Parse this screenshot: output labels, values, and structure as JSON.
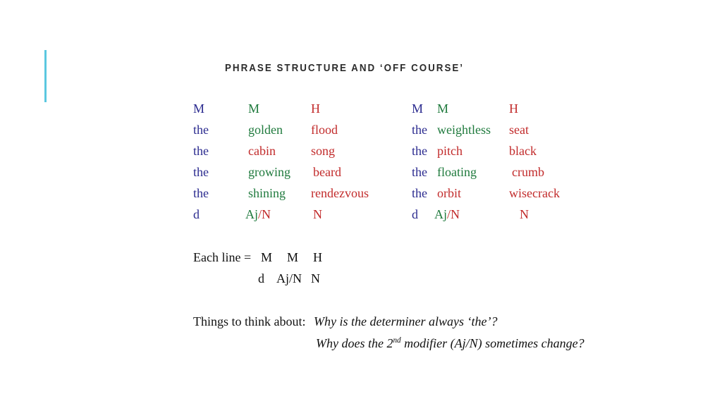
{
  "slide": {
    "title": "PHRASE STRUCTURE AND ‘OFF COURSE’",
    "accent_color": "#5BC8E0",
    "colors": {
      "modifier_1": "#2B2B8F",
      "modifier_2": "#1F7A3D",
      "head": "#C22B2B",
      "title": "#2b2b2b",
      "body": "#111111"
    }
  },
  "tables": {
    "left": {
      "header": {
        "m1": "M",
        "m2": "M",
        "head": "H"
      },
      "rows": [
        {
          "m1": "the",
          "m2": "golden",
          "m2_color": "modifier_2",
          "head": "flood"
        },
        {
          "m1": "the",
          "m2": "cabin",
          "m2_color": "head",
          "head": "song"
        },
        {
          "m1": "the",
          "m2": "growing",
          "m2_color": "modifier_2",
          "head": "beard"
        },
        {
          "m1": "the",
          "m2": "shining",
          "m2_color": "modifier_2",
          "head": "rendezvous"
        }
      ],
      "footer": {
        "m1": "d",
        "m2_adj": "Aj",
        "m2_sep": "/",
        "m2_noun": "N",
        "head": "N"
      }
    },
    "right": {
      "header": {
        "m1": "M",
        "m2": "M",
        "head": "H"
      },
      "rows": [
        {
          "m1": "the",
          "m2": "weightless",
          "m2_color": "modifier_2",
          "head": "seat"
        },
        {
          "m1": "the",
          "m2": "pitch",
          "m2_color": "head",
          "head": "black"
        },
        {
          "m1": "the",
          "m2": "floating",
          "m2_color": "modifier_2",
          "head": "crumb"
        },
        {
          "m1": "the",
          "m2": "orbit",
          "m2_color": "head",
          "head": "wisecrack"
        }
      ],
      "footer": {
        "m1": "d",
        "m2_adj": "Aj",
        "m2_sep": "/",
        "m2_noun": "N",
        "head": "N"
      }
    }
  },
  "legend": {
    "label": "Each line =",
    "line1": {
      "g0": "M",
      "g1": "M",
      "g2": "H"
    },
    "line2": {
      "g0": "d",
      "g1": "Aj/N",
      "g2": "N"
    }
  },
  "think_about": {
    "label": "Things to think about:",
    "question_1": "Why is the determiner always ‘the’?",
    "question_2_before": "Why does the 2",
    "question_2_sup": "nd",
    "question_2_after": " modifier (Aj/N) sometimes change?"
  }
}
